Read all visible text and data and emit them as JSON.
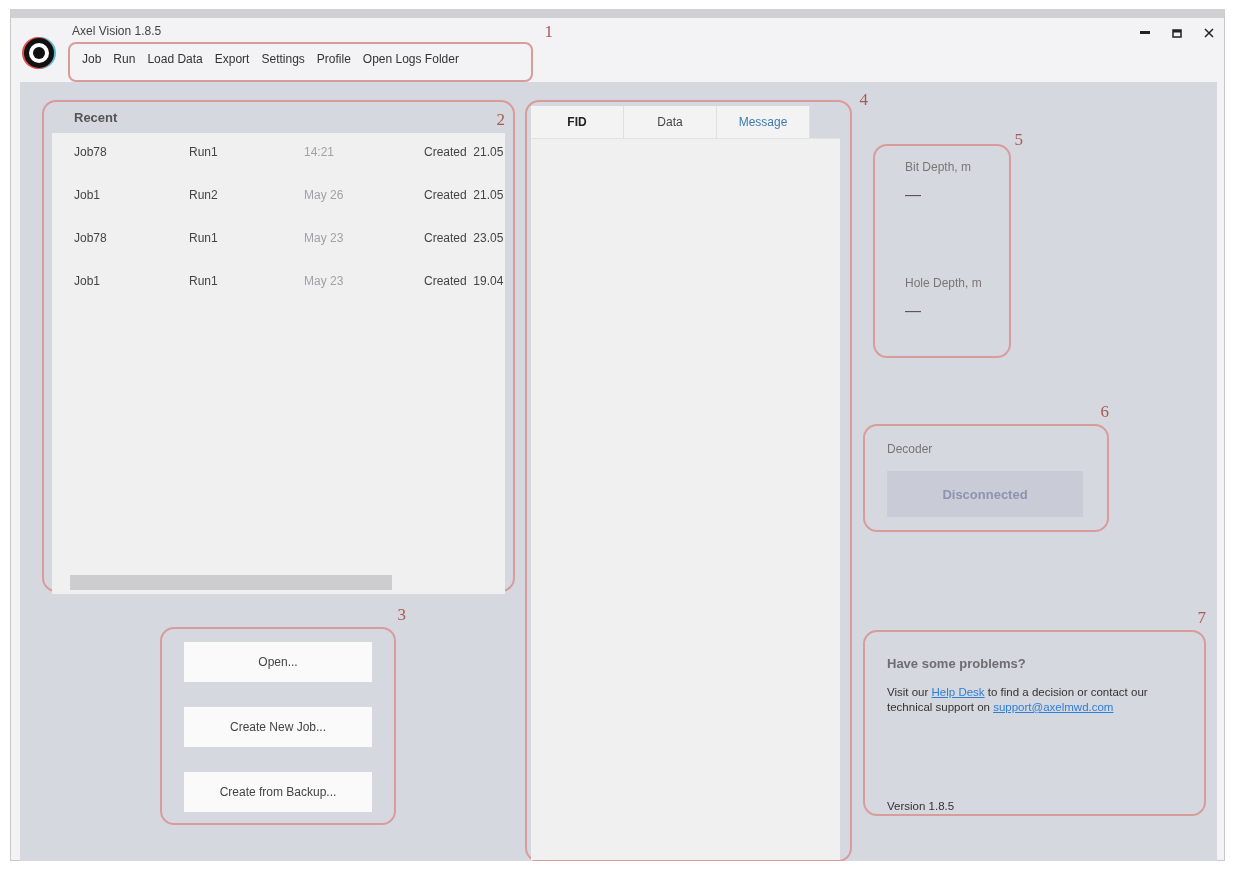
{
  "window": {
    "title": "Axel Vision 1.8.5"
  },
  "menu": {
    "callout": "1",
    "items": [
      "Job",
      "Run",
      "Load Data",
      "Export",
      "Settings",
      "Profile",
      "Open Logs Folder"
    ]
  },
  "recent": {
    "callout": "2",
    "title": "Recent",
    "rows": [
      {
        "job": "Job78",
        "run": "Run1",
        "date": "14:21",
        "created": "Created  21.05"
      },
      {
        "job": "Job1",
        "run": "Run2",
        "date": "May 26",
        "created": "Created  21.05"
      },
      {
        "job": "Job78",
        "run": "Run1",
        "date": "May 23",
        "created": "Created  23.05"
      },
      {
        "job": "Job1",
        "run": "Run1",
        "date": "May 23",
        "created": "Created  19.04"
      }
    ]
  },
  "actions": {
    "callout": "3",
    "buttons": [
      "Open...",
      "Create New Job...",
      "Create from Backup..."
    ]
  },
  "log": {
    "callout": "4",
    "tabs": [
      {
        "label": "FID",
        "selected": true,
        "highlighted": false
      },
      {
        "label": "Data",
        "selected": false,
        "highlighted": false
      },
      {
        "label": "Message",
        "selected": false,
        "highlighted": true
      }
    ]
  },
  "depth": {
    "callout": "5",
    "readings": [
      {
        "label": "Bit Depth, m",
        "value": "—"
      },
      {
        "label": "Hole Depth, m",
        "value": "—"
      }
    ]
  },
  "decoder": {
    "callout": "6",
    "label": "Decoder",
    "status": "Disconnected"
  },
  "help": {
    "callout": "7",
    "title": "Have some problems?",
    "message": [
      {
        "kind": "text",
        "text": "Visit our "
      },
      {
        "kind": "link",
        "text": "Help Desk"
      },
      {
        "kind": "text",
        "text": " to find a decision or contact our technical support on "
      },
      {
        "kind": "link",
        "text": "support@axelmwd.com"
      }
    ],
    "version": "Version 1.8.5"
  }
}
